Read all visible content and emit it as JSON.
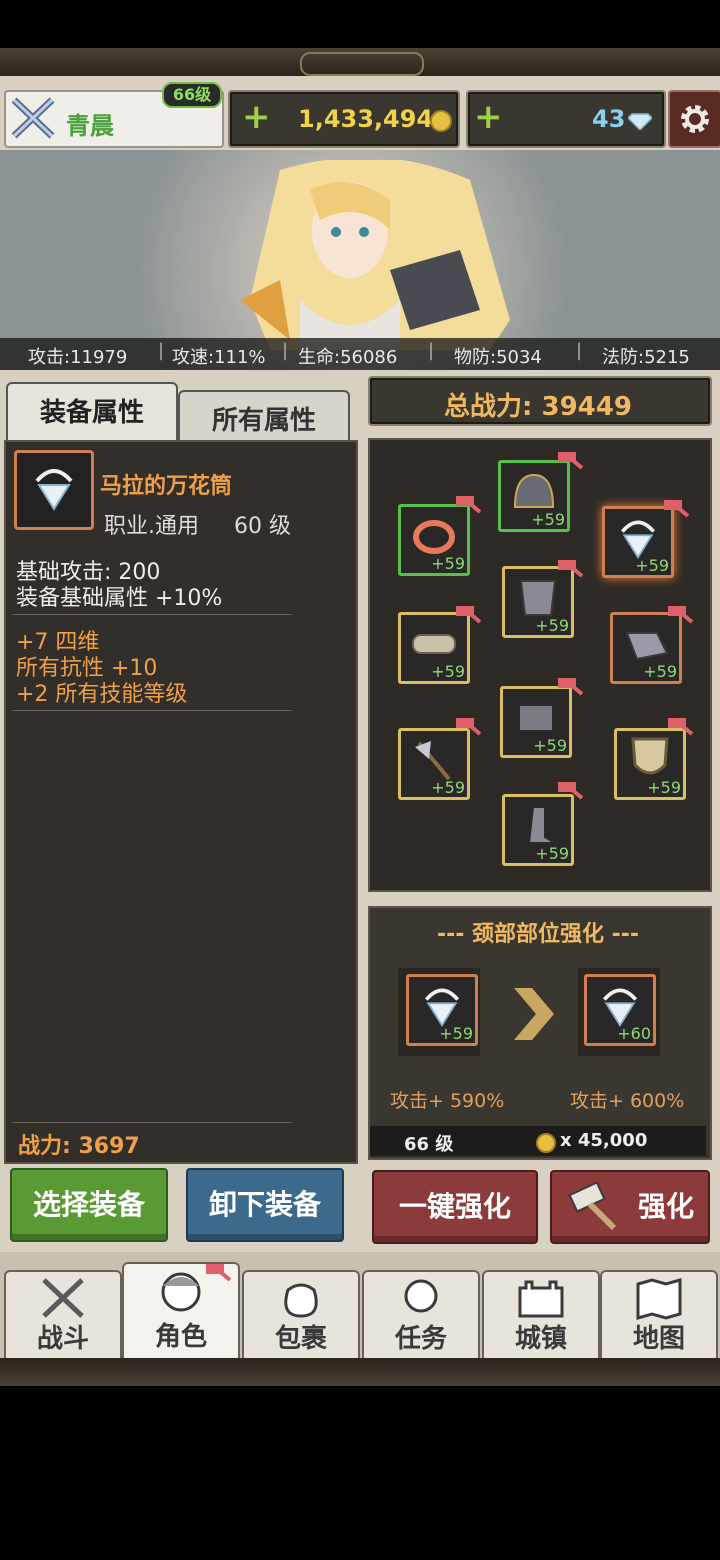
{
  "header": {
    "player_name": "青晨",
    "level_badge": "66级",
    "gold_amount": "1,433,494",
    "gem_amount": "43"
  },
  "banner": {
    "stats": [
      "攻击:11979",
      "攻速:111%",
      "生命:56086",
      "物防:5034",
      "法防:5215"
    ]
  },
  "left_panel": {
    "tabs": [
      "装备属性",
      "所有属性"
    ],
    "item_name": "马拉的万花筒",
    "item_class": "职业.通用",
    "item_level": "60 级",
    "base_stats": [
      "基础攻击:  200",
      "装备基础属性 +10%"
    ],
    "bonus_stats": [
      "+7 四维",
      "所有抗性 +10",
      "+2 所有技能等级"
    ],
    "power_label": "战力: 3697"
  },
  "right_panel": {
    "total_power_label": "总战力: 39449",
    "slots_level": "+59",
    "upgrade_title": "--- 颈部部位强化 ---",
    "from_level": "+59",
    "to_level": "+60",
    "from_stat": "攻击+ 590%",
    "to_stat": "攻击+ 600%",
    "req_level": "66 级",
    "cost": "x 45,000"
  },
  "buttons": {
    "select_equip": "选择装备",
    "unequip": "卸下装备",
    "one_click_upgrade": "一键强化",
    "upgrade": "强化"
  },
  "nav": {
    "tabs": [
      "战斗",
      "角色",
      "包裹",
      "任务",
      "城镇",
      "地图"
    ]
  },
  "colors": {
    "select_btn": "#5a9a34",
    "unequip_btn": "#3c6a8c",
    "upgrade_btn": "#8c3a3a",
    "orange_text": "#f0a048",
    "gold_text": "#f2d24a"
  }
}
